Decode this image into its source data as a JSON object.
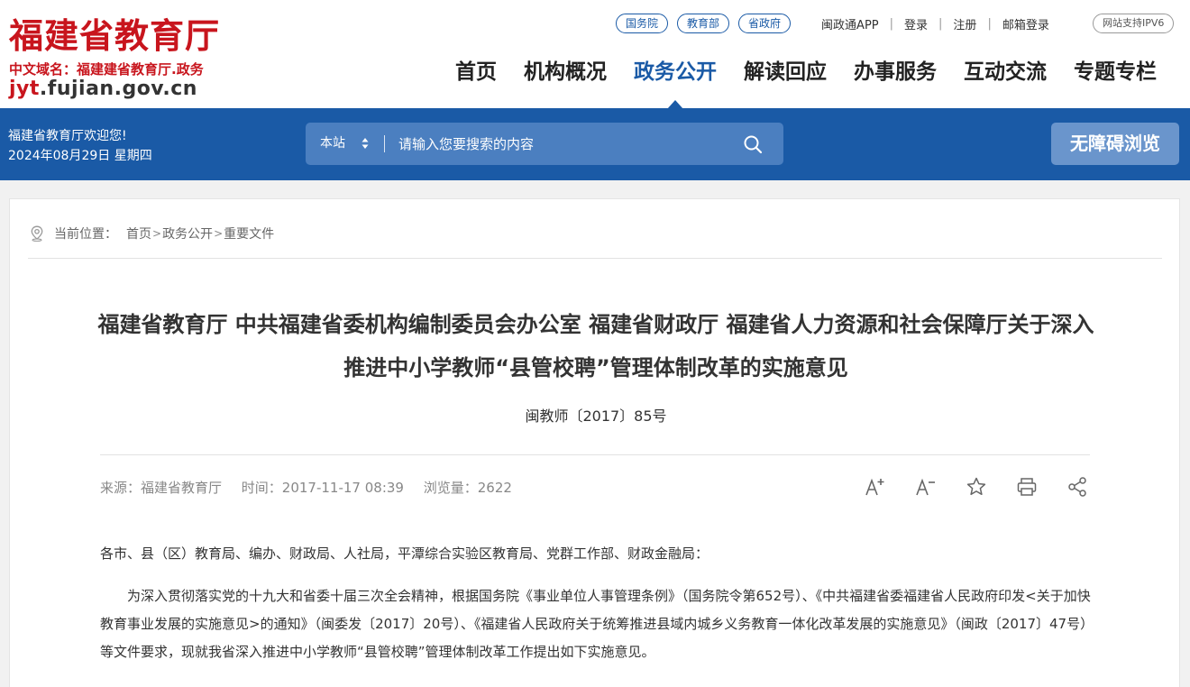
{
  "header": {
    "logo_title": "福建省教育厅",
    "logo_domain": "中文域名：福建建省教育厅.政务",
    "logo_url_jyt": "jyt",
    "logo_url_rest": ".fujian.gov.cn",
    "gov_links": [
      "国务院",
      "教育部",
      "省政府"
    ],
    "util_links": [
      "闽政通APP",
      "登录",
      "注册",
      "邮箱登录"
    ],
    "ipv6": "网站支持IPV6",
    "nav": [
      "首页",
      "机构概况",
      "政务公开",
      "解读回应",
      "办事服务",
      "互动交流",
      "专题专栏"
    ],
    "nav_active": "政务公开"
  },
  "bar": {
    "welcome": "福建省教育厅欢迎您!",
    "date": "2024年08月29日 星期四",
    "scope": "本站",
    "search_placeholder": "请输入您要搜索的内容",
    "access": "无障碍浏览"
  },
  "breadcrumb": {
    "label": "当前位置：",
    "items": [
      "首页",
      "政务公开",
      "重要文件"
    ]
  },
  "article": {
    "title": "福建省教育厅 中共福建省委机构编制委员会办公室 福建省财政厅 福建省人力资源和社会保障厅关于深入推进中小学教师“县管校聘”管理体制改革的实施意见",
    "doc_number": "闽教师〔2017〕85号",
    "source": "来源：福建省教育厅",
    "time": "时间：2017-11-17 08:39",
    "views": "浏览量：2622",
    "tools": [
      "font-increase-icon",
      "font-decrease-icon",
      "favorite-star-icon",
      "print-icon",
      "share-icon"
    ],
    "para1": "各市、县（区）教育局、编办、财政局、人社局，平潭综合实验区教育局、党群工作部、财政金融局：",
    "para2": "为深入贯彻落实党的十九大和省委十届三次全会精神，根据国务院《事业单位人事管理条例》（国务院令第652号）、《中共福建省委福建省人民政府印发<关于加快教育事业发展的实施意见>的通知》（闽委发〔2017〕20号）、《福建省人民政府关于统筹推进县域内城乡义务教育一体化改革发展的实施意见》（闽政〔2017〕47号）等文件要求，现就我省深入推进中小学教师“县管校聘”管理体制改革工作提出如下实施意见。"
  },
  "colors": {
    "brand_red": "#c8151d",
    "brand_blue": "#1a5aa6"
  }
}
